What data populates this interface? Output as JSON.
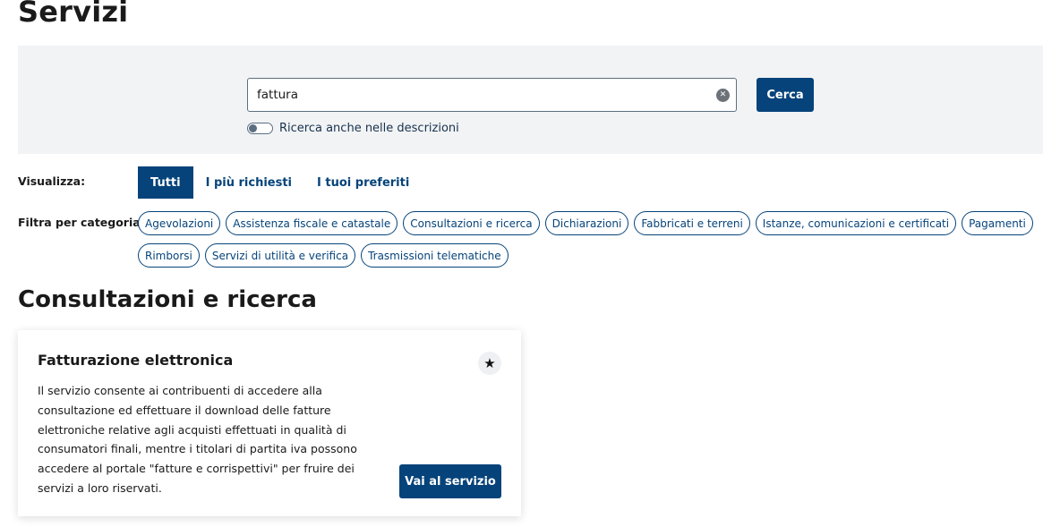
{
  "page_title": "Servizi",
  "search": {
    "value": "fattura",
    "clear_icon": "clear-circle-icon",
    "button_label": "Cerca",
    "toggle_label": "Ricerca anche nelle descrizioni",
    "toggle_on": false
  },
  "view": {
    "label": "Visualizza:",
    "tabs": [
      {
        "label": "Tutti",
        "active": true
      },
      {
        "label": "I più richiesti",
        "active": false
      },
      {
        "label": "I tuoi preferiti",
        "active": false
      }
    ]
  },
  "filter": {
    "label": "Filtra per categoria:",
    "chips": [
      "Agevolazioni",
      "Assistenza fiscale e catastale",
      "Consultazioni e ricerca",
      "Dichiarazioni",
      "Fabbricati e terreni",
      "Istanze, comunicazioni e certificati",
      "Pagamenti",
      "Rimborsi",
      "Servizi di utilità e verifica",
      "Trasmissioni telematiche"
    ]
  },
  "section": {
    "title": "Consultazioni e ricerca",
    "card": {
      "title": "Fatturazione elettronica",
      "fav_icon": "star-icon",
      "description": "Il servizio consente ai contribuenti di accedere alla consultazione ed effettuare il download delle fatture elettroniche relative agli acquisti effettuati in qualità di consumatori finali, mentre i titolari di partita iva possono accedere al portale \"fatture e corrispettivi\" per fruire dei servizi a loro riservati.",
      "button_label": "Vai al servizio"
    }
  },
  "colors": {
    "primary": "#06437a",
    "panel_bg": "#f2f3f5"
  }
}
